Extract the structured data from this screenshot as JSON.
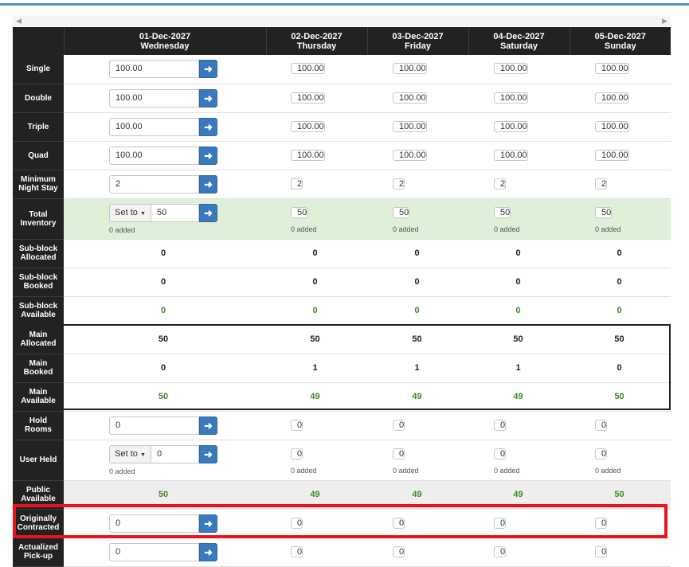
{
  "scroll": {
    "left_arrow": "◀",
    "right_arrow": "▶"
  },
  "columns": [
    {
      "date": "01-Dec-2027",
      "day": "Wednesday"
    },
    {
      "date": "02-Dec-2027",
      "day": "Thursday"
    },
    {
      "date": "03-Dec-2027",
      "day": "Friday"
    },
    {
      "date": "04-Dec-2027",
      "day": "Saturday"
    },
    {
      "date": "05-Dec-2027",
      "day": "Sunday"
    }
  ],
  "rows": {
    "single": {
      "label": "Single",
      "values": [
        "100.00",
        "100.00",
        "100.00",
        "100.00",
        "100.00"
      ]
    },
    "double": {
      "label": "Double",
      "values": [
        "100.00",
        "100.00",
        "100.00",
        "100.00",
        "100.00"
      ]
    },
    "triple": {
      "label": "Triple",
      "values": [
        "100.00",
        "100.00",
        "100.00",
        "100.00",
        "100.00"
      ]
    },
    "quad": {
      "label": "Quad",
      "values": [
        "100.00",
        "100.00",
        "100.00",
        "100.00",
        "100.00"
      ]
    },
    "min_night": {
      "label_1": "Minimum",
      "label_2": "Night Stay",
      "values": [
        "2",
        "2",
        "2",
        "2",
        "2"
      ]
    },
    "total_inventory": {
      "label_1": "Total",
      "label_2": "Inventory",
      "set_to": "Set to",
      "values": [
        "50",
        "50",
        "50",
        "50",
        "50"
      ],
      "added": "0 added"
    },
    "sub_allocated": {
      "label_1": "Sub-block",
      "label_2": "Allocated",
      "values": [
        "0",
        "0",
        "0",
        "0",
        "0"
      ]
    },
    "sub_booked": {
      "label_1": "Sub-block",
      "label_2": "Booked",
      "values": [
        "0",
        "0",
        "0",
        "0",
        "0"
      ]
    },
    "sub_available": {
      "label_1": "Sub-block",
      "label_2": "Available",
      "values": [
        "0",
        "0",
        "0",
        "0",
        "0"
      ]
    },
    "main_allocated": {
      "label_1": "Main",
      "label_2": "Allocated",
      "values": [
        "50",
        "50",
        "50",
        "50",
        "50"
      ]
    },
    "main_booked": {
      "label_1": "Main",
      "label_2": "Booked",
      "values": [
        "0",
        "1",
        "1",
        "1",
        "0"
      ]
    },
    "main_available": {
      "label_1": "Main",
      "label_2": "Available",
      "values": [
        "50",
        "49",
        "49",
        "49",
        "50"
      ]
    },
    "hold_rooms": {
      "label_1": "Hold",
      "label_2": "Rooms",
      "values": [
        "0",
        "0",
        "0",
        "0",
        "0"
      ]
    },
    "user_held": {
      "label": "User Held",
      "set_to": "Set to",
      "values": [
        "0",
        "0",
        "0",
        "0",
        "0"
      ],
      "added": "0 added"
    },
    "public_available": {
      "label_1": "Public",
      "label_2": "Available",
      "values": [
        "50",
        "49",
        "49",
        "49",
        "50"
      ]
    },
    "originally_contracted": {
      "label_1": "Originally",
      "label_2": "Contracted",
      "values": [
        "0",
        "0",
        "0",
        "0",
        "0"
      ]
    },
    "actualized_pickup": {
      "label_1": "Actualized",
      "label_2": "Pick-up",
      "values": [
        "0",
        "0",
        "0",
        "0",
        "0"
      ]
    }
  },
  "icons": {
    "apply": "arrow-right-icon",
    "dropdown": "caret-down-icon"
  },
  "colors": {
    "header_bg": "#222222",
    "apply_button": "#3b79bd",
    "available_text": "#3c8a24",
    "inventory_row_bg": "#dff0d8",
    "highlight": "#e8141c",
    "top_accent": "#4a90b8"
  }
}
